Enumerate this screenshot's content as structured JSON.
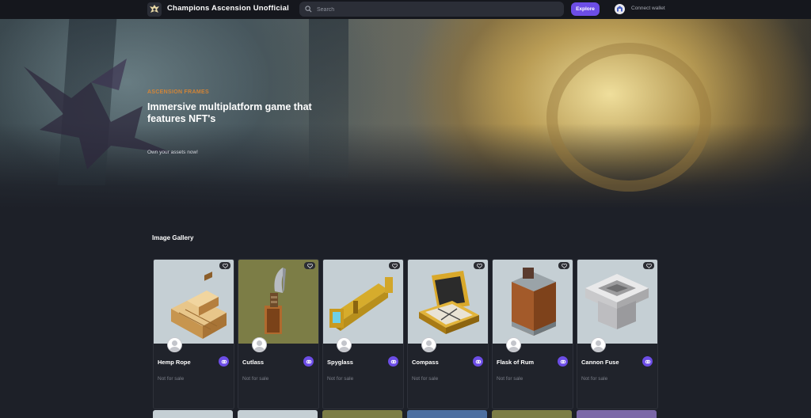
{
  "header": {
    "brand": "Champions Ascension Unofficial",
    "search_placeholder": "Search",
    "explore_label": "Explore",
    "wallet_label": "Connect wallet"
  },
  "hero": {
    "eyebrow": "ASCENSION FRAMES",
    "title": "Immersive multiplatform game that features NFT's",
    "subtitle": "Own your assets now!"
  },
  "gallery": {
    "title": "Image Gallery",
    "items": [
      {
        "name": "Hemp Rope",
        "status": "Not for sale",
        "bg": "#c5cfd4"
      },
      {
        "name": "Cutlass",
        "status": "Not for sale",
        "bg": "#7c7d46"
      },
      {
        "name": "Spyglass",
        "status": "Not for sale",
        "bg": "#c5cfd4"
      },
      {
        "name": "Compass",
        "status": "Not for sale",
        "bg": "#c5cfd4"
      },
      {
        "name": "Flask of Rum",
        "status": "Not for sale",
        "bg": "#c5cfd4"
      },
      {
        "name": "Cannon Fuse",
        "status": "Not for sale",
        "bg": "#c5cfd4"
      }
    ],
    "row2_colors": [
      "#c5cfd4",
      "#c5cfd4",
      "#7c7d46",
      "#4d6fa0",
      "#7c7d46",
      "#7b68a8"
    ]
  },
  "colors": {
    "accent": "#6c4de6",
    "background": "#1d2028",
    "topbar": "#15171d"
  }
}
